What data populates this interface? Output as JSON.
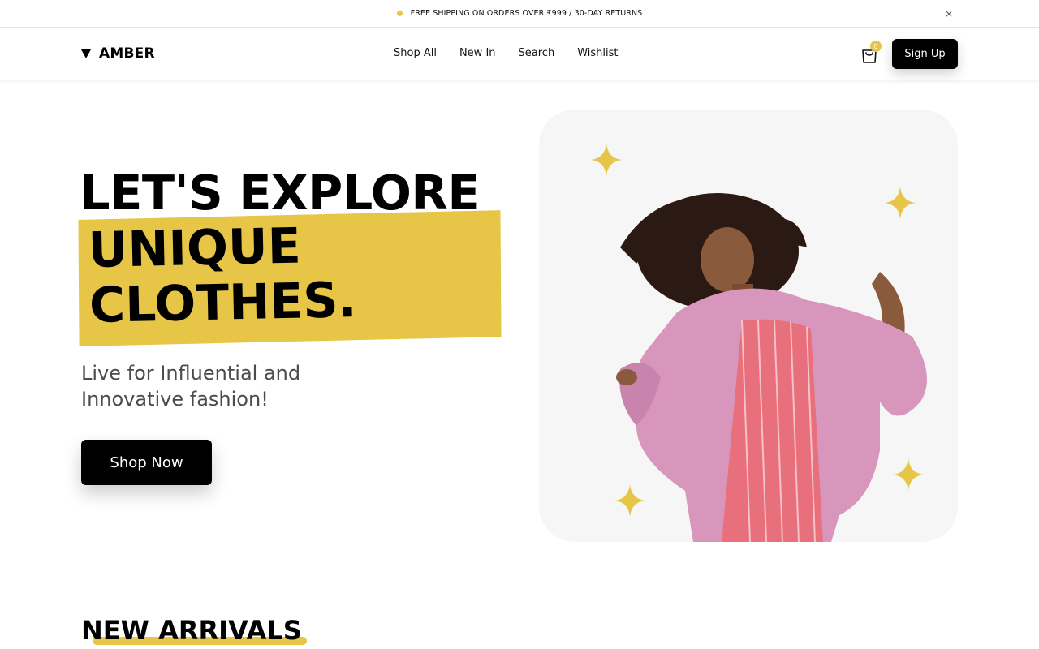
{
  "announcement": {
    "text": "FREE SHIPPING ON ORDERS OVER ₹999 / 30-DAY RETURNS",
    "close_label": "×"
  },
  "header": {
    "logo": "AMBER",
    "nav": [
      "Shop All",
      "New In",
      "Search",
      "Wishlist"
    ],
    "cart_count": "0",
    "signup_label": "Sign Up"
  },
  "hero": {
    "title_line1": "LET'S EXPLORE",
    "highlight_line1": "UNIQUE",
    "highlight_line2": "CLOTHES.",
    "subtitle": "Live for Influential and Innovative fashion!",
    "cta_label": "Shop Now"
  },
  "section": {
    "title": "NEW ARRIVALS"
  },
  "colors": {
    "accent": "#e6c547",
    "primary": "#000000",
    "card_bg": "#f6f6f6"
  }
}
